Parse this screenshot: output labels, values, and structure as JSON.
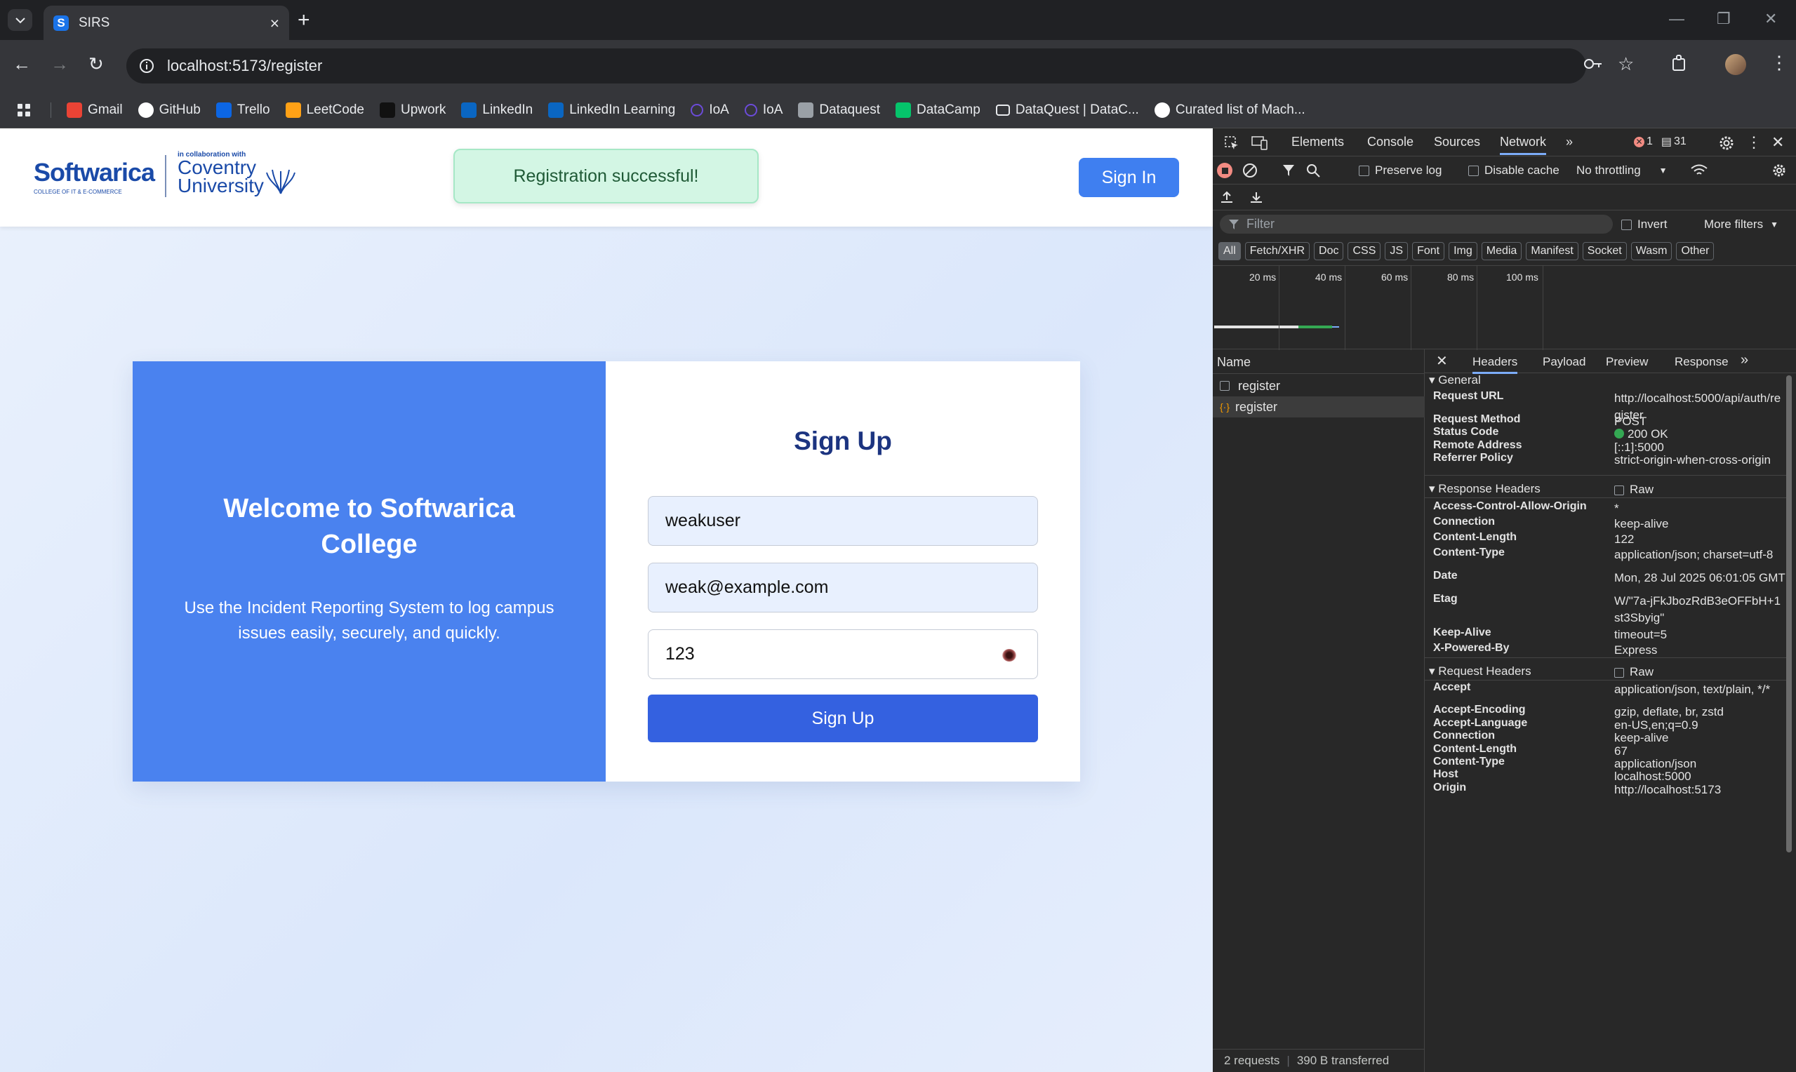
{
  "browser": {
    "tab_title": "SIRS",
    "favicon_letter": "S",
    "url": "localhost:5173/register",
    "bookmarks": [
      {
        "label": "Gmail",
        "icon": "gmail-icon",
        "color": "#ea4335"
      },
      {
        "label": "GitHub",
        "icon": "github-icon",
        "color": "#ffffff"
      },
      {
        "label": "Trello",
        "icon": "trello-icon",
        "color": "#0c66e4"
      },
      {
        "label": "LeetCode",
        "icon": "leetcode-icon",
        "color": "#ffa116"
      },
      {
        "label": "Upwork",
        "icon": "upwork-icon",
        "color": "#111111"
      },
      {
        "label": "LinkedIn",
        "icon": "linkedin-icon",
        "color": "#0a66c2"
      },
      {
        "label": "LinkedIn Learning",
        "icon": "linkedin-icon",
        "color": "#0a66c2"
      },
      {
        "label": "IoA",
        "icon": "ioa-icon",
        "color": "#6b4bd8"
      },
      {
        "label": "IoA",
        "icon": "ioa-icon",
        "color": "#6b4bd8"
      },
      {
        "label": "Dataquest",
        "icon": "dataquest-icon",
        "color": "#9aa0a6"
      },
      {
        "label": "DataCamp",
        "icon": "datacamp-icon",
        "color": "#05c46b"
      },
      {
        "label": "DataQuest | DataC...",
        "icon": "folder-icon",
        "color": "#e8eaed"
      },
      {
        "label": "Curated list of Mach...",
        "icon": "github-icon",
        "color": "#ffffff"
      }
    ]
  },
  "site": {
    "logo_main": "Softwarica",
    "logo_sub": "COLLEGE OF IT & E-COMMERCE",
    "collab_text": "in collaboration with",
    "coventry_line1": "Coventry",
    "coventry_line2": "University",
    "toast": "Registration successful!",
    "signin_label": "Sign In"
  },
  "card": {
    "welcome_title": "Welcome to Softwarica College",
    "welcome_text": "Use the Incident Reporting System to log campus issues easily, securely, and quickly.",
    "form_title": "Sign Up",
    "username": "weakuser",
    "email": "weak@example.com",
    "password": "123",
    "submit_label": "Sign Up"
  },
  "devtools": {
    "tabs": [
      "Elements",
      "Console",
      "Sources",
      "Network"
    ],
    "errors": "1",
    "messages": "31",
    "preserve_log": "Preserve log",
    "disable_cache": "Disable cache",
    "throttling": "No throttling",
    "filter_placeholder": "Filter",
    "invert": "Invert",
    "more_filters": "More filters",
    "filter_types": [
      "All",
      "Fetch/XHR",
      "Doc",
      "CSS",
      "JS",
      "Font",
      "Img",
      "Media",
      "Manifest",
      "Socket",
      "Wasm",
      "Other"
    ],
    "timeline_labels": [
      "20 ms",
      "40 ms",
      "60 ms",
      "80 ms",
      "100 ms"
    ],
    "name_header": "Name",
    "requests": [
      "register",
      "register"
    ],
    "detail_tabs": [
      "Headers",
      "Payload",
      "Preview",
      "Response"
    ],
    "general_title": "General",
    "general": [
      {
        "k": "Request URL",
        "v": "http://localhost:5000/api/auth/register"
      },
      {
        "k": "Request Method",
        "v": "POST"
      },
      {
        "k": "Status Code",
        "v": "200 OK"
      },
      {
        "k": "Remote Address",
        "v": "[::1]:5000"
      },
      {
        "k": "Referrer Policy",
        "v": "strict-origin-when-cross-origin"
      }
    ],
    "response_headers_title": "Response Headers",
    "raw": "Raw",
    "response_headers": [
      {
        "k": "Access-Control-Allow-Origin",
        "v": "*"
      },
      {
        "k": "Connection",
        "v": "keep-alive"
      },
      {
        "k": "Content-Length",
        "v": "122"
      },
      {
        "k": "Content-Type",
        "v": "application/json; charset=utf-8"
      },
      {
        "k": "Date",
        "v": "Mon, 28 Jul 2025 06:01:05 GMT"
      },
      {
        "k": "Etag",
        "v": "W/\"7a-jFkJbozRdB3eOFFbH+1st3Sbyig\""
      },
      {
        "k": "Keep-Alive",
        "v": "timeout=5"
      },
      {
        "k": "X-Powered-By",
        "v": "Express"
      }
    ],
    "request_headers_title": "Request Headers",
    "request_headers": [
      {
        "k": "Accept",
        "v": "application/json, text/plain, */*"
      },
      {
        "k": "Accept-Encoding",
        "v": "gzip, deflate, br, zstd"
      },
      {
        "k": "Accept-Language",
        "v": "en-US,en;q=0.9"
      },
      {
        "k": "Connection",
        "v": "keep-alive"
      },
      {
        "k": "Content-Length",
        "v": "67"
      },
      {
        "k": "Content-Type",
        "v": "application/json"
      },
      {
        "k": "Host",
        "v": "localhost:5000"
      },
      {
        "k": "Origin",
        "v": "http://localhost:5173"
      }
    ],
    "status_requests": "2 requests",
    "status_transferred": "390 B transferred"
  }
}
